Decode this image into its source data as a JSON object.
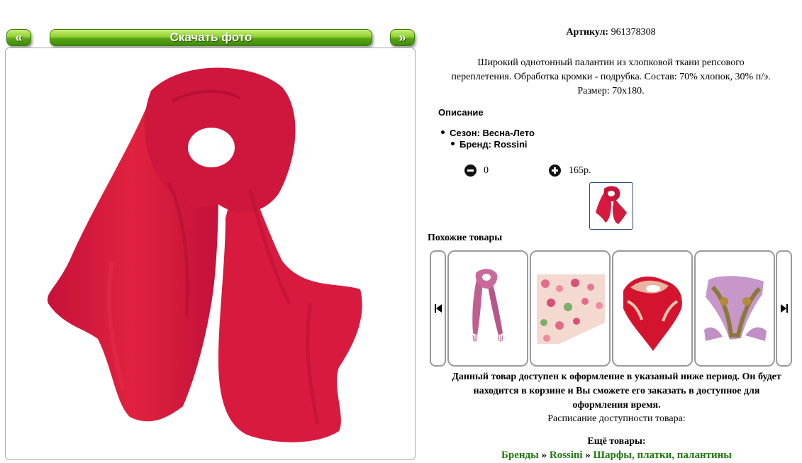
{
  "gallery": {
    "prev_label": "«",
    "download_label": "Скачать фото",
    "next_label": "»"
  },
  "product": {
    "article_label": "Артикул:",
    "article_value": "961378308",
    "description_lines": [
      "Широкий однотонный палантин из хлопковой ткани репсового",
      "переплетения. Обработка кромки - подрубка. Состав: 70% хлопок, 30% п/э.",
      "Размер: 70х180."
    ],
    "description_heading": "Описание",
    "attributes": [
      "Сезон: Весна-Лето",
      "Бренд: Rossini"
    ],
    "quantity": "0",
    "price": "165р."
  },
  "similar": {
    "title": "Похожие товары",
    "items": [
      "pink-scarf",
      "floral-scarf",
      "red-paisley-shawl",
      "purple-paisley-scarf"
    ]
  },
  "availability": {
    "note_lines": [
      "Данный товар доступен к оформление в указаный ниже период. Он будет",
      "находится в корзине и Вы сможете его заказать в доступное для",
      "оформления время."
    ],
    "schedule_label": "Расписание доступности товара:"
  },
  "more": {
    "title": "Ещё товары:",
    "breadcrumbs": [
      "Бренды",
      "Rossini",
      "Шарфы, платки, палантины"
    ],
    "separator": "»"
  },
  "colors": {
    "accent_green": "#5aa616",
    "link_green": "#1f7a12",
    "scarf_red": "#d8193f"
  }
}
